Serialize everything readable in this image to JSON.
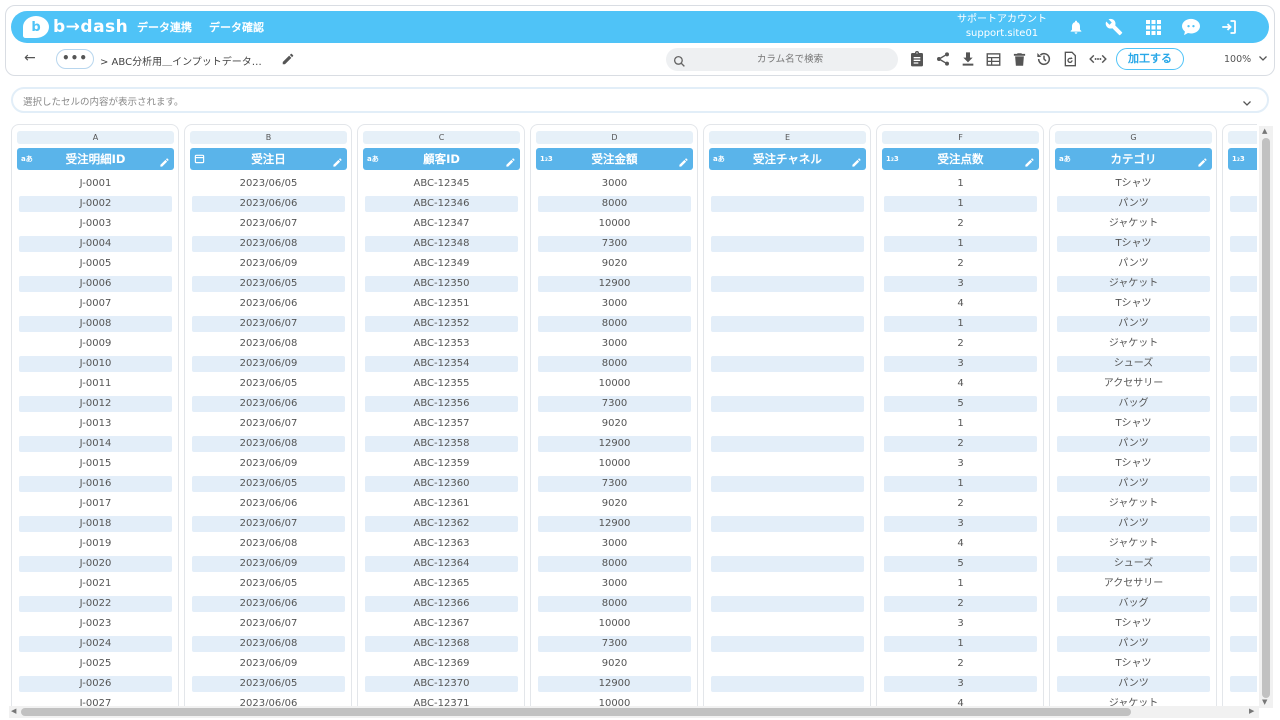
{
  "app": {
    "logo_text": "b→dash",
    "logo_mark": "b"
  },
  "nav": {
    "item1": "データ連携",
    "item2": "データ確認"
  },
  "account": {
    "line1": "サポートアカウント",
    "line2": "support.site01"
  },
  "toolbar": {
    "back_glyph": "←",
    "more_glyph": "•••",
    "breadcrumb": "> ABC分析用＿インプットデータ…",
    "search_placeholder": "カラム名で検索",
    "process_button": "加工する",
    "zoom": "100%"
  },
  "cell_display": {
    "placeholder": "選択したセルの内容が表示されます。"
  },
  "columns": [
    {
      "letter": "A",
      "name": "受注明細ID",
      "type": "text",
      "type_badge": "aあ"
    },
    {
      "letter": "B",
      "name": "受注日",
      "type": "date",
      "type_badge": ""
    },
    {
      "letter": "C",
      "name": "顧客ID",
      "type": "text",
      "type_badge": "aあ"
    },
    {
      "letter": "D",
      "name": "受注金額",
      "type": "number",
      "type_badge": "1₂3"
    },
    {
      "letter": "E",
      "name": "受注チャネル",
      "type": "text",
      "type_badge": "aあ"
    },
    {
      "letter": "F",
      "name": "受注点数",
      "type": "number",
      "type_badge": "1₂3"
    },
    {
      "letter": "G",
      "name": "カテゴリ",
      "type": "text",
      "type_badge": "aあ"
    },
    {
      "letter": "",
      "name": "",
      "type": "number",
      "type_badge": "1₂3"
    }
  ],
  "rows": [
    [
      "J-0001",
      "2023/06/05",
      "ABC-12345",
      "3000",
      "",
      "1",
      "Tシャツ",
      ""
    ],
    [
      "J-0002",
      "2023/06/06",
      "ABC-12346",
      "8000",
      "",
      "1",
      "パンツ",
      ""
    ],
    [
      "J-0003",
      "2023/06/07",
      "ABC-12347",
      "10000",
      "",
      "2",
      "ジャケット",
      ""
    ],
    [
      "J-0004",
      "2023/06/08",
      "ABC-12348",
      "7300",
      "",
      "1",
      "Tシャツ",
      ""
    ],
    [
      "J-0005",
      "2023/06/09",
      "ABC-12349",
      "9020",
      "",
      "2",
      "パンツ",
      ""
    ],
    [
      "J-0006",
      "2023/06/05",
      "ABC-12350",
      "12900",
      "",
      "3",
      "ジャケット",
      ""
    ],
    [
      "J-0007",
      "2023/06/06",
      "ABC-12351",
      "3000",
      "",
      "4",
      "Tシャツ",
      ""
    ],
    [
      "J-0008",
      "2023/06/07",
      "ABC-12352",
      "8000",
      "",
      "1",
      "パンツ",
      ""
    ],
    [
      "J-0009",
      "2023/06/08",
      "ABC-12353",
      "3000",
      "",
      "2",
      "ジャケット",
      ""
    ],
    [
      "J-0010",
      "2023/06/09",
      "ABC-12354",
      "8000",
      "",
      "3",
      "シューズ",
      ""
    ],
    [
      "J-0011",
      "2023/06/05",
      "ABC-12355",
      "10000",
      "",
      "4",
      "アクセサリー",
      ""
    ],
    [
      "J-0012",
      "2023/06/06",
      "ABC-12356",
      "7300",
      "",
      "5",
      "バッグ",
      ""
    ],
    [
      "J-0013",
      "2023/06/07",
      "ABC-12357",
      "9020",
      "",
      "1",
      "Tシャツ",
      ""
    ],
    [
      "J-0014",
      "2023/06/08",
      "ABC-12358",
      "12900",
      "",
      "2",
      "パンツ",
      ""
    ],
    [
      "J-0015",
      "2023/06/09",
      "ABC-12359",
      "10000",
      "",
      "3",
      "Tシャツ",
      ""
    ],
    [
      "J-0016",
      "2023/06/05",
      "ABC-12360",
      "7300",
      "",
      "1",
      "パンツ",
      ""
    ],
    [
      "J-0017",
      "2023/06/06",
      "ABC-12361",
      "9020",
      "",
      "2",
      "ジャケット",
      ""
    ],
    [
      "J-0018",
      "2023/06/07",
      "ABC-12362",
      "12900",
      "",
      "3",
      "パンツ",
      ""
    ],
    [
      "J-0019",
      "2023/06/08",
      "ABC-12363",
      "3000",
      "",
      "4",
      "ジャケット",
      ""
    ],
    [
      "J-0020",
      "2023/06/09",
      "ABC-12364",
      "8000",
      "",
      "5",
      "シューズ",
      ""
    ],
    [
      "J-0021",
      "2023/06/05",
      "ABC-12365",
      "3000",
      "",
      "1",
      "アクセサリー",
      ""
    ],
    [
      "J-0022",
      "2023/06/06",
      "ABC-12366",
      "8000",
      "",
      "2",
      "バッグ",
      ""
    ],
    [
      "J-0023",
      "2023/06/07",
      "ABC-12367",
      "10000",
      "",
      "3",
      "Tシャツ",
      ""
    ],
    [
      "J-0024",
      "2023/06/08",
      "ABC-12368",
      "7300",
      "",
      "1",
      "パンツ",
      ""
    ],
    [
      "J-0025",
      "2023/06/09",
      "ABC-12369",
      "9020",
      "",
      "2",
      "Tシャツ",
      ""
    ],
    [
      "J-0026",
      "2023/06/05",
      "ABC-12370",
      "12900",
      "",
      "3",
      "パンツ",
      ""
    ],
    [
      "J-0027",
      "2023/06/06",
      "ABC-12371",
      "10000",
      "",
      "4",
      "ジャケット",
      ""
    ]
  ],
  "colors": {
    "brand": "#4fc3f7",
    "header": "#5ab4ea",
    "stripe": "#e3eef9"
  }
}
